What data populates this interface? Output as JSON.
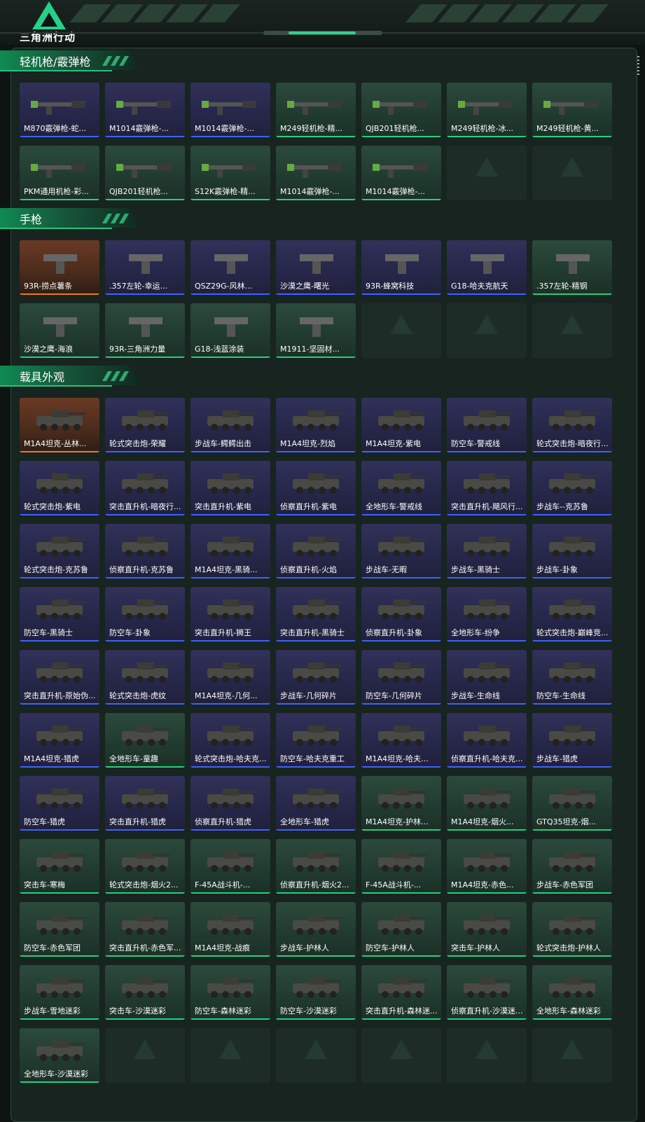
{
  "header": {
    "logo_text": "三角洲行动"
  },
  "sections": [
    {
      "title": "轻机枪/霰弹枪",
      "kind": "gun",
      "items": [
        {
          "label": "M870霰弹枪-蛇...",
          "rarity": "blue"
        },
        {
          "label": "M1014霰弹枪-...",
          "rarity": "blue"
        },
        {
          "label": "M1014霰弹枪-...",
          "rarity": "blue"
        },
        {
          "label": "M249轻机枪-精...",
          "rarity": "green"
        },
        {
          "label": "QJB201轻机枪...",
          "rarity": "green"
        },
        {
          "label": "M249轻机枪-冰...",
          "rarity": "green"
        },
        {
          "label": "M249轻机枪-黄...",
          "rarity": "green"
        },
        {
          "label": "PKM通用机枪-彩...",
          "rarity": "green"
        },
        {
          "label": "QJB201轻机枪...",
          "rarity": "green"
        },
        {
          "label": "S12K霰弹枪-精...",
          "rarity": "green"
        },
        {
          "label": "M1014霰弹枪-...",
          "rarity": "green"
        },
        {
          "label": "M1014霰弹枪-...",
          "rarity": "green"
        },
        {
          "label": "",
          "rarity": "empty"
        },
        {
          "label": "",
          "rarity": "empty"
        }
      ]
    },
    {
      "title": "手枪",
      "kind": "pistol",
      "items": [
        {
          "label": "93R-捞点薯条",
          "rarity": "orange"
        },
        {
          "label": ".357左轮-幸运...",
          "rarity": "blue"
        },
        {
          "label": "QSZ29G-风林...",
          "rarity": "blue"
        },
        {
          "label": "沙漠之鹰-曙光",
          "rarity": "blue"
        },
        {
          "label": "93R-蜂窝科技",
          "rarity": "blue"
        },
        {
          "label": "G18-哈夫克航天",
          "rarity": "blue"
        },
        {
          "label": ".357左轮-精钢",
          "rarity": "green"
        },
        {
          "label": "沙漠之鹰-海浪",
          "rarity": "green"
        },
        {
          "label": "93R-三角洲力量",
          "rarity": "green"
        },
        {
          "label": "G18-浅蓝涂装",
          "rarity": "green"
        },
        {
          "label": "M1911-坚固材...",
          "rarity": "green"
        },
        {
          "label": "",
          "rarity": "empty"
        },
        {
          "label": "",
          "rarity": "empty"
        },
        {
          "label": "",
          "rarity": "empty"
        }
      ]
    },
    {
      "title": "载具外观",
      "kind": "vehicle",
      "items": [
        {
          "label": "M1A4坦克-丛林...",
          "rarity": "orange"
        },
        {
          "label": "轮式突击炮-荣耀",
          "rarity": "blue"
        },
        {
          "label": "步战车-鳄鳄出击",
          "rarity": "blue"
        },
        {
          "label": "M1A4坦克-烈焰",
          "rarity": "blue"
        },
        {
          "label": "M1A4坦克-紫电",
          "rarity": "blue"
        },
        {
          "label": "防空车-警戒线",
          "rarity": "blue"
        },
        {
          "label": "轮式突击炮-暗夜行...",
          "rarity": "blue"
        },
        {
          "label": "轮式突击炮-紫电",
          "rarity": "blue"
        },
        {
          "label": "突击直升机-暗夜行...",
          "rarity": "blue"
        },
        {
          "label": "突击直升机-紫电",
          "rarity": "blue"
        },
        {
          "label": "侦察直升机-紫电",
          "rarity": "blue"
        },
        {
          "label": "全地形车-警戒线",
          "rarity": "blue"
        },
        {
          "label": "突击直升机-飓风行...",
          "rarity": "blue"
        },
        {
          "label": "步战车--克苏鲁",
          "rarity": "blue"
        },
        {
          "label": "轮式突击炮-克苏鲁",
          "rarity": "blue"
        },
        {
          "label": "侦察直升机-克苏鲁",
          "rarity": "blue"
        },
        {
          "label": "M1A4坦克-黑骑...",
          "rarity": "blue"
        },
        {
          "label": "侦察直升机-火焰",
          "rarity": "blue"
        },
        {
          "label": "步战车-无暇",
          "rarity": "blue"
        },
        {
          "label": "步战车-黑骑士",
          "rarity": "blue"
        },
        {
          "label": "步战车-卦象",
          "rarity": "blue"
        },
        {
          "label": "防空车-黑骑士",
          "rarity": "blue"
        },
        {
          "label": "防空车-卦象",
          "rarity": "blue"
        },
        {
          "label": "突击直升机-狮王",
          "rarity": "blue"
        },
        {
          "label": "突击直升机-黑骑士",
          "rarity": "blue"
        },
        {
          "label": "侦察直升机-卦象",
          "rarity": "blue"
        },
        {
          "label": "全地形车-纷争",
          "rarity": "blue"
        },
        {
          "label": "轮式突击炮-巅峰竞...",
          "rarity": "blue"
        },
        {
          "label": "突击直升机-原始伪...",
          "rarity": "blue"
        },
        {
          "label": "轮式突击炮-虎纹",
          "rarity": "blue"
        },
        {
          "label": "M1A4坦克-几何...",
          "rarity": "blue"
        },
        {
          "label": "步战车-几何碎片",
          "rarity": "blue"
        },
        {
          "label": "防空车-几何碎片",
          "rarity": "blue"
        },
        {
          "label": "步战车-生命线",
          "rarity": "blue"
        },
        {
          "label": "防空车-生命线",
          "rarity": "blue"
        },
        {
          "label": "M1A4坦克-猎虎",
          "rarity": "blue"
        },
        {
          "label": "全地形车-童趣",
          "rarity": "green"
        },
        {
          "label": "轮式突击炮-哈夫克...",
          "rarity": "blue"
        },
        {
          "label": "防空车-哈夫克重工",
          "rarity": "blue"
        },
        {
          "label": "M1A4坦克-哈夫...",
          "rarity": "blue"
        },
        {
          "label": "侦察直升机-哈夫克...",
          "rarity": "blue"
        },
        {
          "label": "步战车-猎虎",
          "rarity": "blue"
        },
        {
          "label": "防空车-猎虎",
          "rarity": "blue"
        },
        {
          "label": "突击直升机-猎虎",
          "rarity": "blue"
        },
        {
          "label": "侦察直升机-猎虎",
          "rarity": "blue"
        },
        {
          "label": "全地形车-猎虎",
          "rarity": "blue"
        },
        {
          "label": "M1A4坦克-护林...",
          "rarity": "green"
        },
        {
          "label": "M1A4坦克-烟火...",
          "rarity": "green"
        },
        {
          "label": "GTQ35坦克-烟...",
          "rarity": "green"
        },
        {
          "label": "突击车-寒梅",
          "rarity": "green"
        },
        {
          "label": "轮式突击炮-烟火2...",
          "rarity": "green"
        },
        {
          "label": "F-45A战斗机-...",
          "rarity": "green"
        },
        {
          "label": "侦察直升机-烟火2...",
          "rarity": "green"
        },
        {
          "label": "F-45A战斗机-...",
          "rarity": "green"
        },
        {
          "label": "M1A4坦克-赤色...",
          "rarity": "green"
        },
        {
          "label": "步战车-赤色军团",
          "rarity": "green"
        },
        {
          "label": "防空车-赤色军团",
          "rarity": "green"
        },
        {
          "label": "突击直升机-赤色军...",
          "rarity": "green"
        },
        {
          "label": "M1A4坦克-战痕",
          "rarity": "green"
        },
        {
          "label": "步战车-护林人",
          "rarity": "green"
        },
        {
          "label": "防空车-护林人",
          "rarity": "green"
        },
        {
          "label": "突击车-护林人",
          "rarity": "green"
        },
        {
          "label": "轮式突击炮-护林人",
          "rarity": "green"
        },
        {
          "label": "步战车-雪地迷彩",
          "rarity": "green"
        },
        {
          "label": "突击车-沙漠迷彩",
          "rarity": "green"
        },
        {
          "label": "防空车-森林迷彩",
          "rarity": "green"
        },
        {
          "label": "防空车-沙漠迷彩",
          "rarity": "green"
        },
        {
          "label": "突击直升机-森林迷...",
          "rarity": "green"
        },
        {
          "label": "侦察直升机-沙漠迷...",
          "rarity": "green"
        },
        {
          "label": "全地形车-森林迷彩",
          "rarity": "green"
        },
        {
          "label": "全地形车-沙漠迷彩",
          "rarity": "green"
        },
        {
          "label": "",
          "rarity": "empty"
        },
        {
          "label": "",
          "rarity": "empty"
        },
        {
          "label": "",
          "rarity": "empty"
        },
        {
          "label": "",
          "rarity": "empty"
        },
        {
          "label": "",
          "rarity": "empty"
        },
        {
          "label": "",
          "rarity": "empty"
        }
      ]
    }
  ]
}
